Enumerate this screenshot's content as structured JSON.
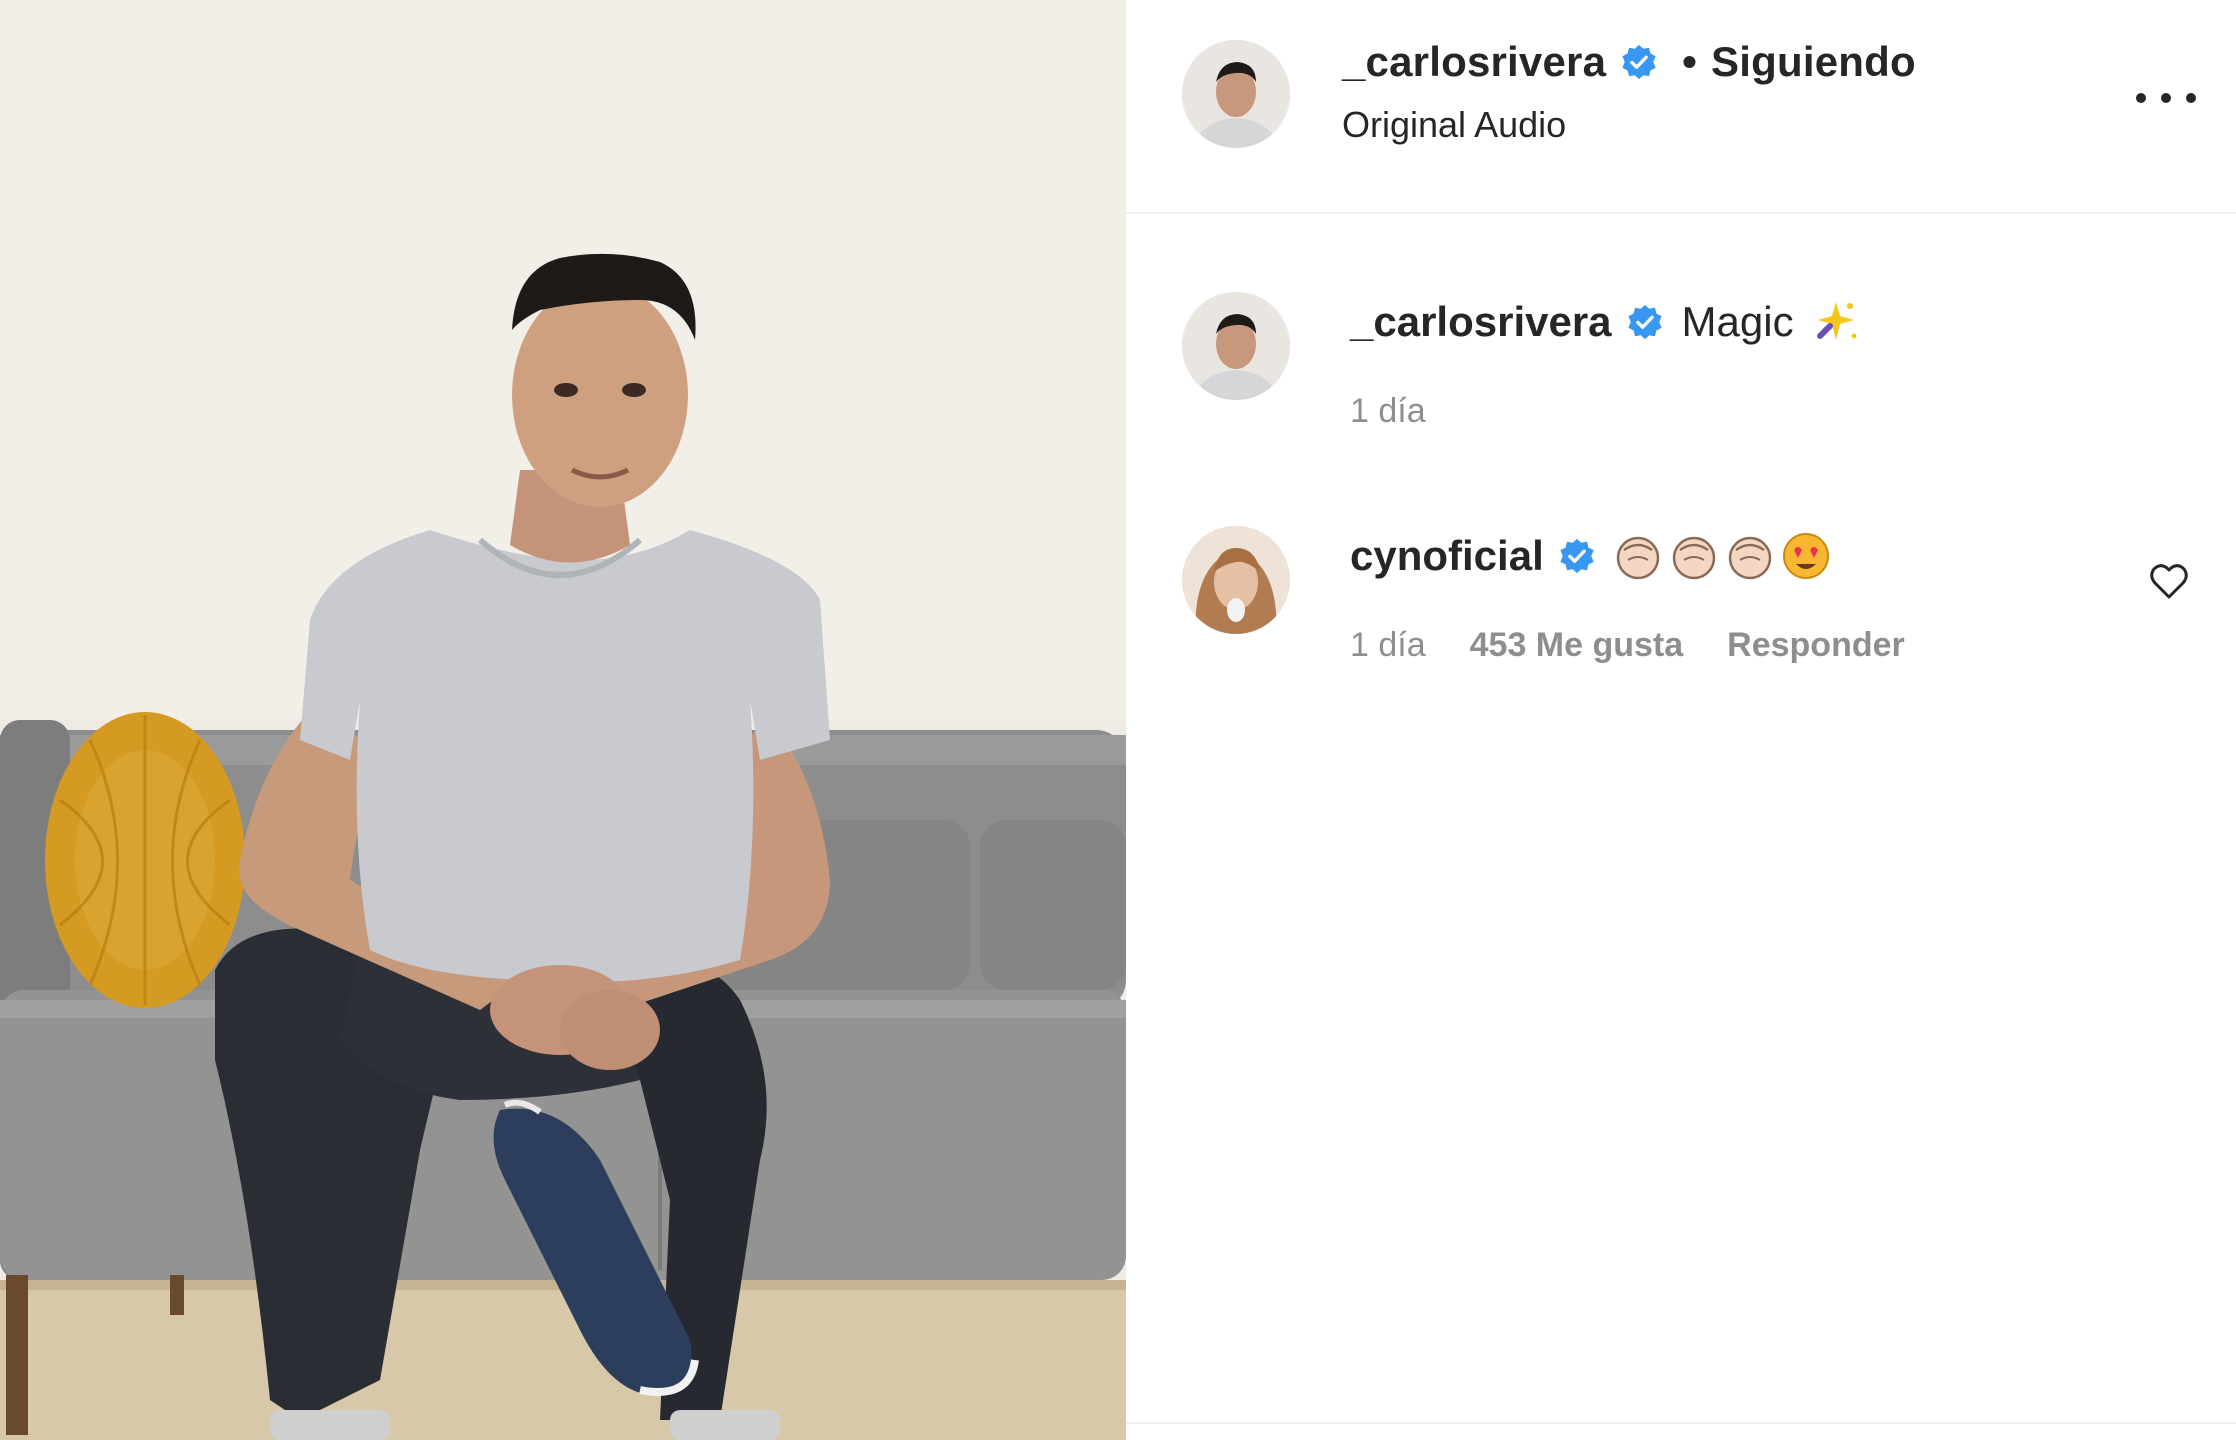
{
  "post_author": {
    "username": "_carlosrivera",
    "verified": true,
    "follow_separator": "•",
    "follow_status": "Siguiendo",
    "audio": "Original Audio"
  },
  "more_options_icon": "more-horizontal-icon",
  "comments": [
    {
      "username": "_carlosrivera",
      "verified": true,
      "text": "Magic",
      "emoji": [
        "sparkle-icon"
      ],
      "time": "1 día"
    },
    {
      "username": "cynoficial",
      "verified": true,
      "text": "",
      "emoji": [
        "clap-icon",
        "clap-icon",
        "clap-icon",
        "heart-eyes-icon"
      ],
      "time": "1 día",
      "likes": "453 Me gusta",
      "reply": "Responder"
    }
  ],
  "colors": {
    "verified_blue": "#3897f0",
    "text_primary": "#262626",
    "text_secondary": "#8e8e8e",
    "sofa_gray": "#8c8c8c",
    "pillow_mustard": "#d49a22",
    "wall": "#f0ece6"
  }
}
